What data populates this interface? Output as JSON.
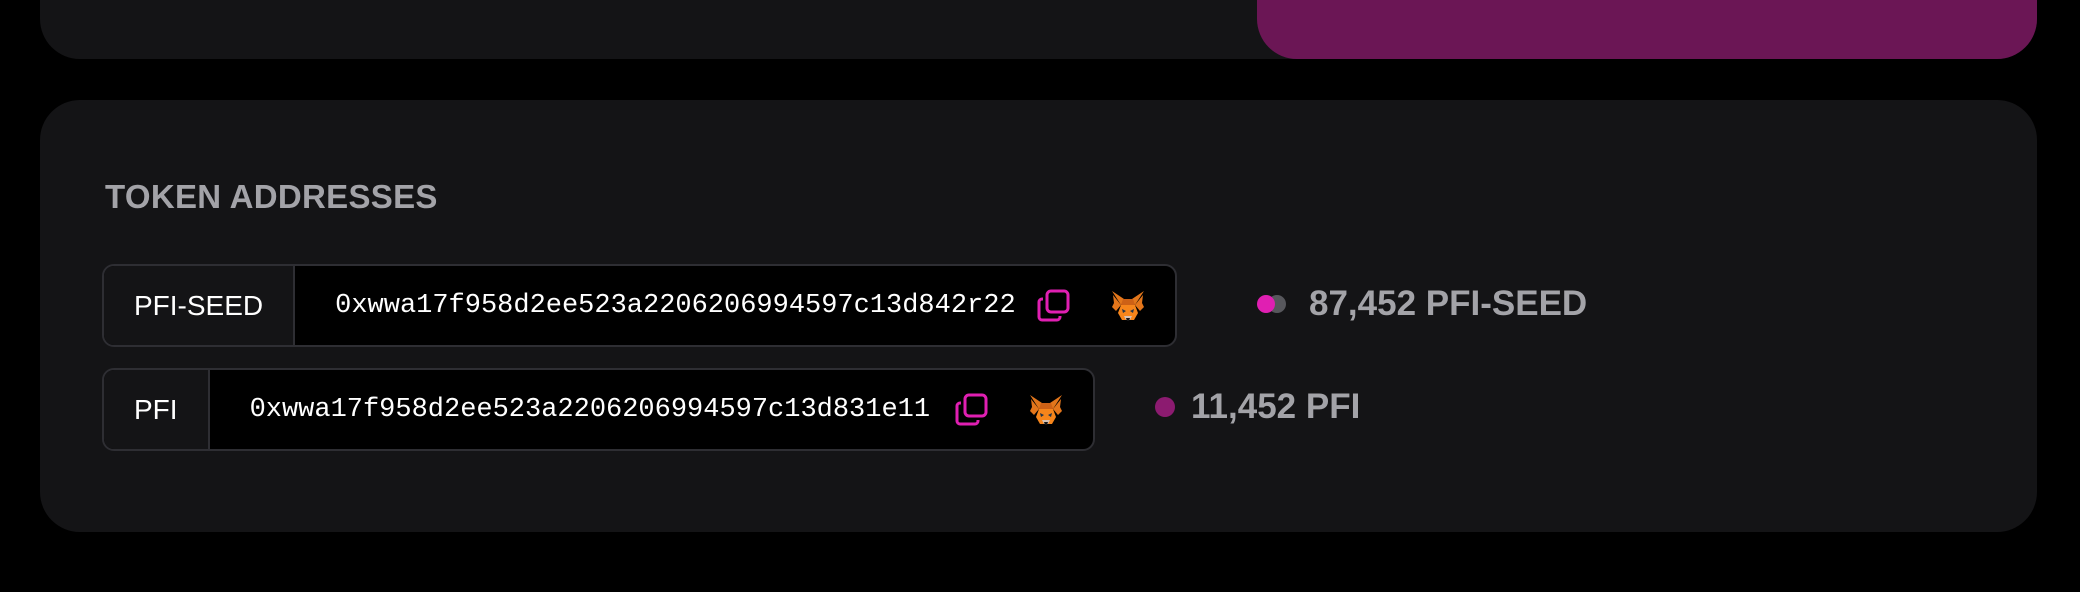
{
  "colors": {
    "background": "#000000",
    "card": "#141416",
    "accent_panel": "#6b1655",
    "copy_icon": "#e01fb2",
    "seed_dot": "#e01fb2",
    "seed_dot_secondary": "#57575c",
    "pfi_dot": "#8c1b70"
  },
  "section_title": "TOKEN ADDRESSES",
  "tokens": [
    {
      "label": "PFI-SEED",
      "address": "0xwwa17f958d2ee523a2206206994597c13d842r22",
      "copy_icon": "copy-icon",
      "wallet_icon": "metamask-fox-icon",
      "balance": "87,452 PFI-SEED"
    },
    {
      "label": "PFI",
      "address": "0xwwa17f958d2ee523a2206206994597c13d831e11",
      "copy_icon": "copy-icon",
      "wallet_icon": "metamask-fox-icon",
      "balance": "11,452 PFI"
    }
  ]
}
